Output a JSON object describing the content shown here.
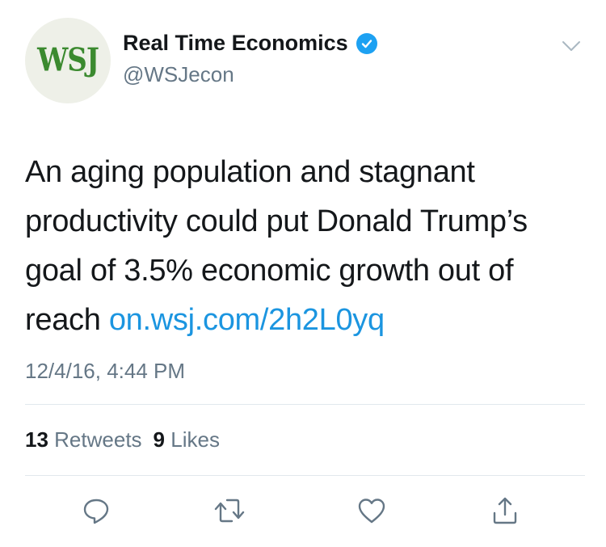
{
  "author": {
    "avatar_text": "WSJ",
    "display_name": "Real Time Economics",
    "verified": true,
    "handle": "@WSJecon"
  },
  "tweet": {
    "text": "An aging population and stagnant productivity could put Donald Trump’s goal of 3.5% economic growth out of reach ",
    "link_text": "on.wsj.com/2h2L0yq",
    "timestamp": "12/4/16, 4:44 PM"
  },
  "stats": {
    "retweets_count": "13",
    "retweets_label": "Retweets",
    "likes_count": "9",
    "likes_label": "Likes"
  },
  "actions": {
    "icons": [
      "reply-icon",
      "retweet-icon",
      "like-icon",
      "share-icon"
    ]
  },
  "colors": {
    "link": "#1b95e0",
    "verified": "#1da1f2",
    "secondary_text": "#657786",
    "wsj_green": "#3b8a2f"
  }
}
